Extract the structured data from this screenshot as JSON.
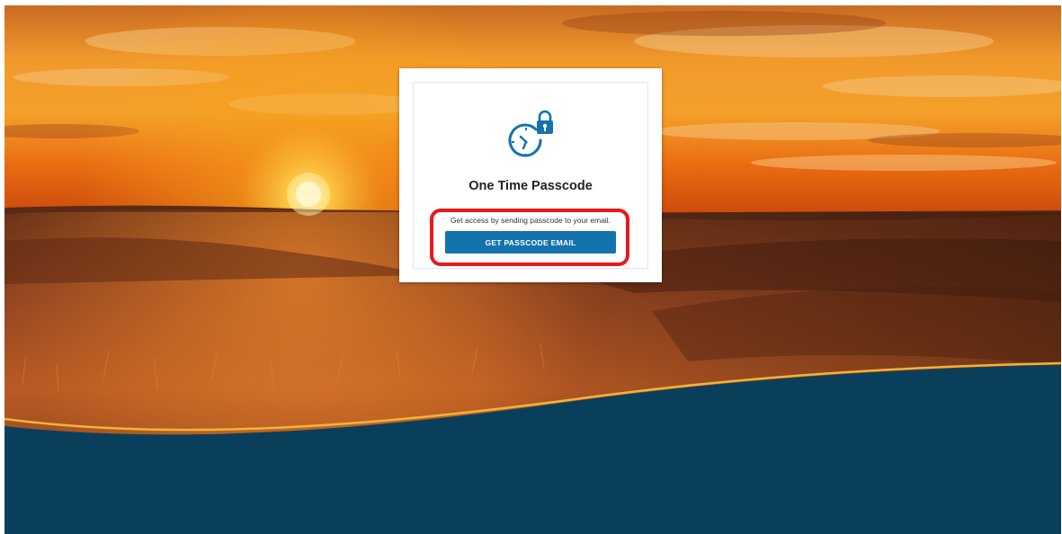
{
  "card": {
    "title": "One Time Passcode",
    "description": "Get access by sending passcode to your email.",
    "button_label": "GET PASSCODE EMAIL",
    "icon": "clock-lock-icon"
  },
  "colors": {
    "accent": "#1473ad",
    "footer": "#0a3f5c",
    "highlight": "#e8191e",
    "wave_line": "#f0b43c"
  }
}
